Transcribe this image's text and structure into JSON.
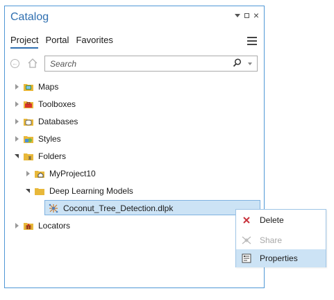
{
  "pane": {
    "title": "Catalog"
  },
  "window_controls": {
    "pin": "▾",
    "close": "×"
  },
  "tabs": [
    {
      "label": "Project",
      "active": true
    },
    {
      "label": "Portal",
      "active": false
    },
    {
      "label": "Favorites",
      "active": false
    }
  ],
  "search": {
    "placeholder": "Search",
    "value": ""
  },
  "tree": {
    "maps": "Maps",
    "toolboxes": "Toolboxes",
    "databases": "Databases",
    "styles": "Styles",
    "folders": "Folders",
    "myproject": "MyProject10",
    "dl_models": "Deep Learning Models",
    "dlpk_file": "Coconut_Tree_Detection.dlpk",
    "locators": "Locators"
  },
  "context_menu": {
    "items": [
      {
        "label": "Delete",
        "icon": "delete-x-icon",
        "enabled": true
      },
      {
        "label": "Share",
        "icon": "share-icon",
        "enabled": false
      },
      {
        "label": "Properties",
        "icon": "properties-icon",
        "enabled": true,
        "highlighted": true
      }
    ]
  },
  "colors": {
    "accent": "#2f6fb0",
    "selection": "#cce3f5",
    "delete_red": "#c8323c",
    "folder_yellow": "#e8b83a"
  }
}
